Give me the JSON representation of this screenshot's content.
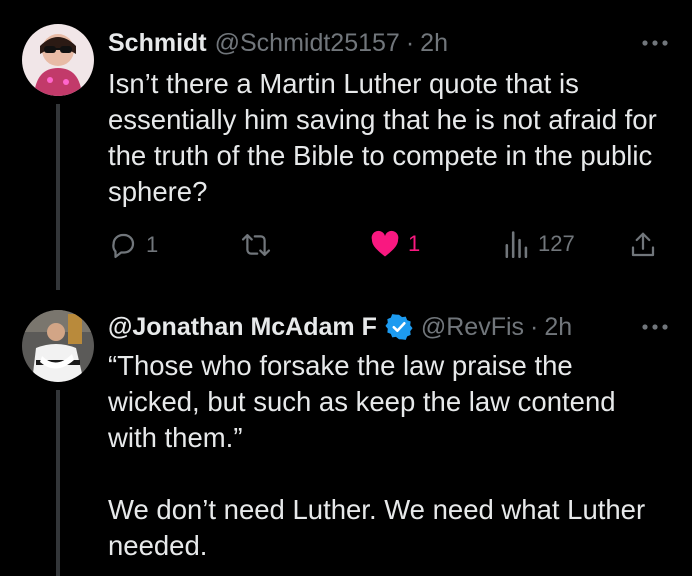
{
  "tweet1": {
    "name": "Schmidt",
    "handle": "@Schmidt25157",
    "separator": "·",
    "time": "2h",
    "text": "Isn’t there a Martin Luther quote that is essentially him saving that he is not afraid for the truth of the Bible to compete in the public sphere?",
    "replies": "1",
    "likes": "1",
    "views": "127",
    "liked": true,
    "like_color": "#f91880"
  },
  "tweet2": {
    "name": "@Jonathan McAdam F",
    "handle": "@RevFis",
    "separator": "·",
    "time": "2h",
    "verified": true,
    "verified_color": "#1d9bf0",
    "text": "“Those who forsake the law praise the wicked, but such as keep the law contend with them.”\n\nWe don’t need Luther. We need what Luther needed."
  },
  "colors": {
    "background": "#000000",
    "text": "#e7e9ea",
    "muted": "#71767b",
    "thread_line": "#333639"
  },
  "icons": [
    "more-icon",
    "reply-icon",
    "retweet-icon",
    "like-icon",
    "views-icon",
    "share-icon",
    "verified-badge-icon"
  ]
}
